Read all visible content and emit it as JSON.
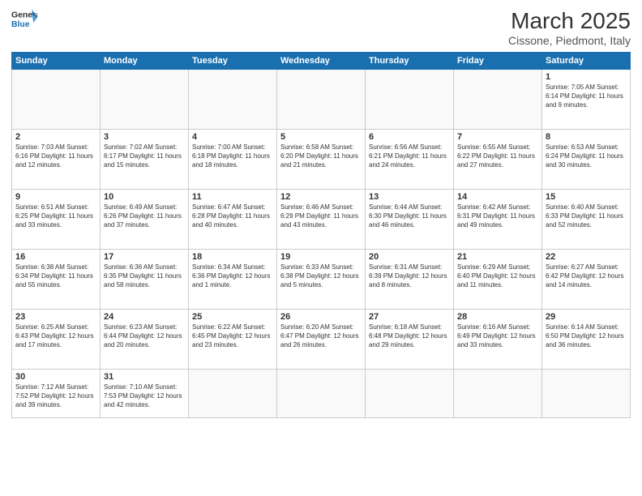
{
  "header": {
    "logo_general": "General",
    "logo_blue": "Blue",
    "month_year": "March 2025",
    "location": "Cissone, Piedmont, Italy"
  },
  "weekdays": [
    "Sunday",
    "Monday",
    "Tuesday",
    "Wednesday",
    "Thursday",
    "Friday",
    "Saturday"
  ],
  "weeks": [
    [
      {
        "day": "",
        "info": ""
      },
      {
        "day": "",
        "info": ""
      },
      {
        "day": "",
        "info": ""
      },
      {
        "day": "",
        "info": ""
      },
      {
        "day": "",
        "info": ""
      },
      {
        "day": "",
        "info": ""
      },
      {
        "day": "1",
        "info": "Sunrise: 7:05 AM\nSunset: 6:14 PM\nDaylight: 11 hours\nand 9 minutes."
      }
    ],
    [
      {
        "day": "2",
        "info": "Sunrise: 7:03 AM\nSunset: 6:16 PM\nDaylight: 11 hours\nand 12 minutes."
      },
      {
        "day": "3",
        "info": "Sunrise: 7:02 AM\nSunset: 6:17 PM\nDaylight: 11 hours\nand 15 minutes."
      },
      {
        "day": "4",
        "info": "Sunrise: 7:00 AM\nSunset: 6:18 PM\nDaylight: 11 hours\nand 18 minutes."
      },
      {
        "day": "5",
        "info": "Sunrise: 6:58 AM\nSunset: 6:20 PM\nDaylight: 11 hours\nand 21 minutes."
      },
      {
        "day": "6",
        "info": "Sunrise: 6:56 AM\nSunset: 6:21 PM\nDaylight: 11 hours\nand 24 minutes."
      },
      {
        "day": "7",
        "info": "Sunrise: 6:55 AM\nSunset: 6:22 PM\nDaylight: 11 hours\nand 27 minutes."
      },
      {
        "day": "8",
        "info": "Sunrise: 6:53 AM\nSunset: 6:24 PM\nDaylight: 11 hours\nand 30 minutes."
      }
    ],
    [
      {
        "day": "9",
        "info": "Sunrise: 6:51 AM\nSunset: 6:25 PM\nDaylight: 11 hours\nand 33 minutes."
      },
      {
        "day": "10",
        "info": "Sunrise: 6:49 AM\nSunset: 6:26 PM\nDaylight: 11 hours\nand 37 minutes."
      },
      {
        "day": "11",
        "info": "Sunrise: 6:47 AM\nSunset: 6:28 PM\nDaylight: 11 hours\nand 40 minutes."
      },
      {
        "day": "12",
        "info": "Sunrise: 6:46 AM\nSunset: 6:29 PM\nDaylight: 11 hours\nand 43 minutes."
      },
      {
        "day": "13",
        "info": "Sunrise: 6:44 AM\nSunset: 6:30 PM\nDaylight: 11 hours\nand 46 minutes."
      },
      {
        "day": "14",
        "info": "Sunrise: 6:42 AM\nSunset: 6:31 PM\nDaylight: 11 hours\nand 49 minutes."
      },
      {
        "day": "15",
        "info": "Sunrise: 6:40 AM\nSunset: 6:33 PM\nDaylight: 11 hours\nand 52 minutes."
      }
    ],
    [
      {
        "day": "16",
        "info": "Sunrise: 6:38 AM\nSunset: 6:34 PM\nDaylight: 11 hours\nand 55 minutes."
      },
      {
        "day": "17",
        "info": "Sunrise: 6:36 AM\nSunset: 6:35 PM\nDaylight: 11 hours\nand 58 minutes."
      },
      {
        "day": "18",
        "info": "Sunrise: 6:34 AM\nSunset: 6:36 PM\nDaylight: 12 hours\nand 1 minute."
      },
      {
        "day": "19",
        "info": "Sunrise: 6:33 AM\nSunset: 6:38 PM\nDaylight: 12 hours\nand 5 minutes."
      },
      {
        "day": "20",
        "info": "Sunrise: 6:31 AM\nSunset: 6:39 PM\nDaylight: 12 hours\nand 8 minutes."
      },
      {
        "day": "21",
        "info": "Sunrise: 6:29 AM\nSunset: 6:40 PM\nDaylight: 12 hours\nand 11 minutes."
      },
      {
        "day": "22",
        "info": "Sunrise: 6:27 AM\nSunset: 6:42 PM\nDaylight: 12 hours\nand 14 minutes."
      }
    ],
    [
      {
        "day": "23",
        "info": "Sunrise: 6:25 AM\nSunset: 6:43 PM\nDaylight: 12 hours\nand 17 minutes."
      },
      {
        "day": "24",
        "info": "Sunrise: 6:23 AM\nSunset: 6:44 PM\nDaylight: 12 hours\nand 20 minutes."
      },
      {
        "day": "25",
        "info": "Sunrise: 6:22 AM\nSunset: 6:45 PM\nDaylight: 12 hours\nand 23 minutes."
      },
      {
        "day": "26",
        "info": "Sunrise: 6:20 AM\nSunset: 6:47 PM\nDaylight: 12 hours\nand 26 minutes."
      },
      {
        "day": "27",
        "info": "Sunrise: 6:18 AM\nSunset: 6:48 PM\nDaylight: 12 hours\nand 29 minutes."
      },
      {
        "day": "28",
        "info": "Sunrise: 6:16 AM\nSunset: 6:49 PM\nDaylight: 12 hours\nand 33 minutes."
      },
      {
        "day": "29",
        "info": "Sunrise: 6:14 AM\nSunset: 6:50 PM\nDaylight: 12 hours\nand 36 minutes."
      }
    ],
    [
      {
        "day": "30",
        "info": "Sunrise: 7:12 AM\nSunset: 7:52 PM\nDaylight: 12 hours\nand 39 minutes."
      },
      {
        "day": "31",
        "info": "Sunrise: 7:10 AM\nSunset: 7:53 PM\nDaylight: 12 hours\nand 42 minutes."
      },
      {
        "day": "",
        "info": ""
      },
      {
        "day": "",
        "info": ""
      },
      {
        "day": "",
        "info": ""
      },
      {
        "day": "",
        "info": ""
      },
      {
        "day": "",
        "info": ""
      }
    ]
  ]
}
